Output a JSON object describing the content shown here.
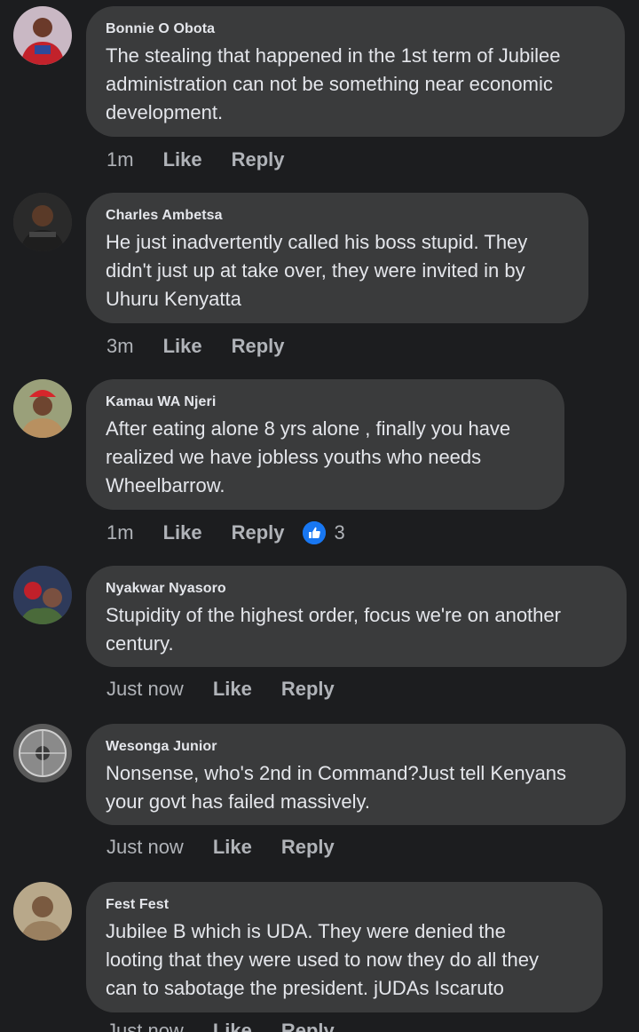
{
  "comments": [
    {
      "author": "Bonnie O Obota",
      "text": "The stealing that happened in the 1st term of Jubilee\nadministration can not be something near economic\ndevelopment.",
      "time": "1m",
      "like_label": "Like",
      "reply_label": "Reply"
    },
    {
      "author": "Charles Ambetsa",
      "text": "He just inadvertently called his boss stupid. They\ndidn't just up at take over, they were invited in by\nUhuru Kenyatta",
      "time": "3m",
      "like_label": "Like",
      "reply_label": "Reply"
    },
    {
      "author": "Kamau WA Njeri",
      "text": "After eating alone 8 yrs alone , finally you have\nrealized we have jobless youths  who needs\nWheelbarrow.",
      "time": "1m",
      "like_label": "Like",
      "reply_label": "Reply",
      "reaction_icon": "thumbs-up-icon",
      "reaction_count": "3"
    },
    {
      "author": "Nyakwar Nyasoro",
      "text": "Stupidity of the highest order, focus we're on another\ncentury.",
      "time": "Just now",
      "like_label": "Like",
      "reply_label": "Reply"
    },
    {
      "author": "Wesonga Junior",
      "text": "Nonsense, who's 2nd in Command?Just tell Kenyans\nyour govt has failed massively.",
      "time": "Just now",
      "like_label": "Like",
      "reply_label": "Reply"
    },
    {
      "author": "Fest Fest",
      "text": "Jubilee B which is UDA. They were denied the\nlooting that they were used to now they do all they\ncan to sabotage the president. jUDAs Iscaruto",
      "time": "Just now",
      "like_label": "Like",
      "reply_label": "Reply"
    }
  ],
  "colors": {
    "background": "#1c1d1f",
    "bubble": "#3a3b3c",
    "text": "#e4e6eb",
    "secondary": "#b0b3b8",
    "like_blue": "#1877f2"
  }
}
